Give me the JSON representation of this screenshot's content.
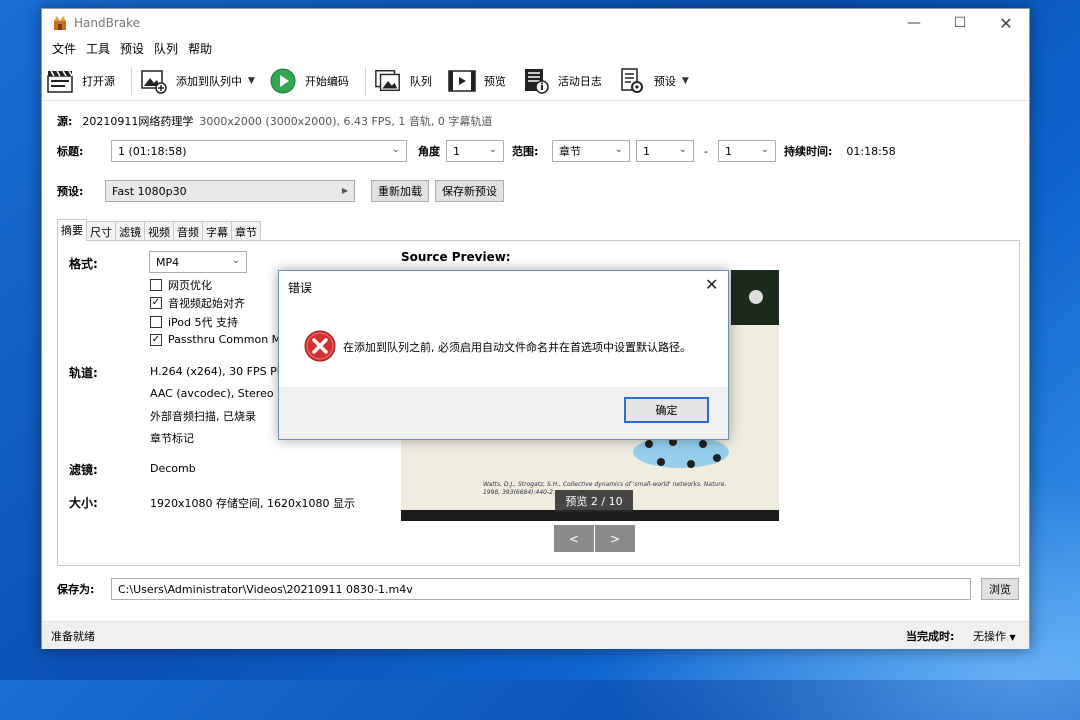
{
  "app": {
    "title": "HandBrake"
  },
  "menu": [
    "文件",
    "工具",
    "预设",
    "队列",
    "帮助"
  ],
  "toolbar": {
    "open_source": "打开源",
    "add_to_queue": "添加到队列中",
    "start_encode": "开始编码",
    "queue": "队列",
    "preview": "预览",
    "activity_log": "活动日志",
    "presets": "预设"
  },
  "source": {
    "label": "源:",
    "name": "20210911网络药理学",
    "info": "3000x2000 (3000x2000), 6.43 FPS, 1 音轨, 0 字幕轨道"
  },
  "title_row": {
    "title_label": "标题:",
    "title_value": "1 (01:18:58)",
    "angle_label": "角度",
    "angle_value": "1",
    "range_label": "范围:",
    "range_type": "章节",
    "range_start": "1",
    "range_dash": "-",
    "range_end": "1",
    "duration_label": "持续时间:",
    "duration_value": "01:18:58"
  },
  "preset_row": {
    "label": "预设:",
    "value": "Fast 1080p30",
    "reload": "重新加载",
    "save_new": "保存新预设"
  },
  "tabs": [
    "摘要",
    "尺寸",
    "滤镜",
    "视频",
    "音频",
    "字幕",
    "章节"
  ],
  "summary": {
    "format_label": "格式:",
    "format_value": "MP4",
    "options": [
      {
        "label": "网页优化",
        "checked": false
      },
      {
        "label": "音视频起始对齐",
        "checked": true
      },
      {
        "label": "iPod 5代 支持",
        "checked": false
      },
      {
        "label": "Passthru Common Me",
        "checked": true
      }
    ],
    "tracks_label": "轨道:",
    "tracks": [
      "H.264 (x264), 30 FPS PFR",
      "AAC (avcodec), Stereo",
      "外部音频扫描, 已烧录",
      "章节标记"
    ],
    "filters_label": "滤镜:",
    "filters_value": "Decomb",
    "size_label": "大小:",
    "size_value": "1920x1080 存储空间, 1620x1080 显示"
  },
  "preview": {
    "heading": "Source Preview:",
    "counter": "预览 2 / 10",
    "prev": "<",
    "next": ">",
    "citation": "Watts, D.J., Strogatz, S.H., Collective dynamics of 'small-world' networks. Nature. 1998, 393(6684):440-2."
  },
  "save": {
    "label": "保存为:",
    "path": "C:\\Users\\Administrator\\Videos\\20210911 0830-1.m4v",
    "browse": "浏览"
  },
  "status": {
    "left": "准备就绪",
    "when_done_label": "当完成时:",
    "when_done_value": "无操作"
  },
  "dialog": {
    "title": "错误",
    "message": "在添加到队列之前, 必须启用自动文件命名并在首选项中设置默认路径。",
    "ok": "确定"
  },
  "colors": {
    "desktop": "#0a4fb3",
    "play_green": "#2fa84f",
    "error_red": "#d62f2f",
    "dialog_border": "#6e8eb8"
  }
}
